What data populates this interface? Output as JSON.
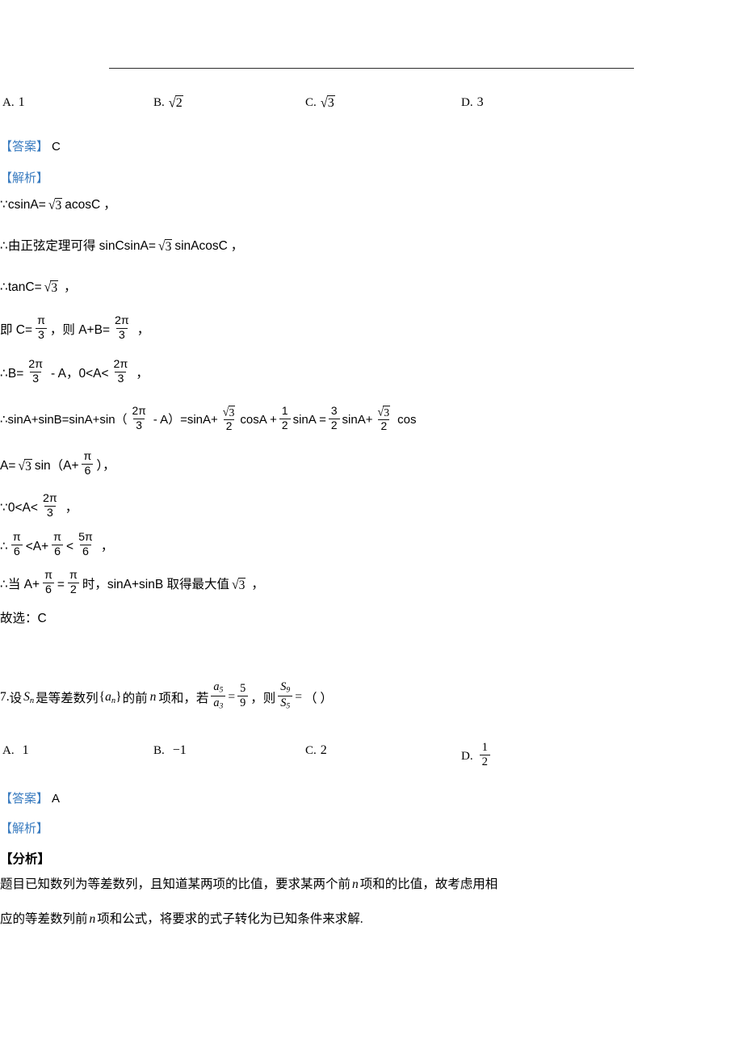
{
  "document": {
    "page_background": "#ffffff",
    "accent_blue": "#3a7cc0"
  },
  "question6": {
    "options": [
      {
        "label": "A.",
        "value": "1",
        "kind": "plain"
      },
      {
        "label": "B.",
        "value": "2",
        "kind": "sqrt"
      },
      {
        "label": "C.",
        "value": "3",
        "kind": "sqrt"
      },
      {
        "label": "D.",
        "value": "3",
        "kind": "plain"
      }
    ],
    "answer_tag": "【答案】",
    "answer_value": "C",
    "analysis_tag": "【解析】",
    "steps": {
      "s1_pre": "∵csinA=",
      "s1_rad": "3",
      "s1_post": "acosC",
      "s1_comma": "，",
      "s2_pre": "∴由正弦定理可得 sinCsinA=",
      "s2_rad": "3",
      "s2_post": "sinAcosC",
      "s2_comma": "，",
      "s3_pre": "∴tanC=",
      "s3_rad": "3",
      "s3_comma": "，",
      "s4_a": "即 C=",
      "s4_f1_num": "π",
      "s4_f1_den": "3",
      "s4_b": "，则 A+B=",
      "s4_f2_num": "2π",
      "s4_f2_den": "3",
      "s4_comma": "，",
      "s5_a": "∴B=",
      "s5_f1_num": "2π",
      "s5_f1_den": "3",
      "s5_b": "- A，0<A<",
      "s5_f2_num": "2π",
      "s5_f2_den": "3",
      "s5_comma": "，",
      "s6_a": "∴sinA+sinB=sinA+sin（",
      "s6_f1_num": "2π",
      "s6_f1_den": "3",
      "s6_b": "- A）=sinA+",
      "s6_f2_num_rad": "3",
      "s6_f2_den": "2",
      "s6_c": "cosA +",
      "s6_f3_num": "1",
      "s6_f3_den": "2",
      "s6_d": "sinA =",
      "s6_f4_num": "3",
      "s6_f4_den": "2",
      "s6_e": "sinA+",
      "s6_f5_num_rad": "3",
      "s6_f5_den": "2",
      "s6_f": "cos",
      "s7_a": "A=",
      "s7_rad": "3",
      "s7_b": "sin（A+",
      "s7_f_num": "π",
      "s7_f_den": "6",
      "s7_c": "），",
      "s8_a": "∵0<A<",
      "s8_f_num": "2π",
      "s8_f_den": "3",
      "s8_comma": "，",
      "s9_a": "∴",
      "s9_f1_num": "π",
      "s9_f1_den": "6",
      "s9_b": "<A+",
      "s9_f2_num": "π",
      "s9_f2_den": "6",
      "s9_c": "<",
      "s9_f3_num": "5π",
      "s9_f3_den": "6",
      "s9_comma": "，",
      "s10_a": "∴当 A+",
      "s10_f1_num": "π",
      "s10_f1_den": "6",
      "s10_b": "=",
      "s10_f2_num": "π",
      "s10_f2_den": "2",
      "s10_c": "时，sinA+sinB 取得最大值",
      "s10_rad": "3",
      "s10_comma": "，",
      "s11": "故选：C"
    }
  },
  "question7": {
    "number": "7.",
    "stem_a": "设",
    "stem_S": "S",
    "stem_S_sub": "n",
    "stem_b": "是等差数列",
    "stem_set_open": "{",
    "stem_a_var": "a",
    "stem_a_sub": "n",
    "stem_set_close": "}",
    "stem_c": "的前",
    "stem_n": "n",
    "stem_d": "项和，若",
    "frac1_num_var": "a",
    "frac1_num_sub": "5",
    "frac1_den_var": "a",
    "frac1_den_sub": "3",
    "eq1": "=",
    "frac2_num": "5",
    "frac2_den": "9",
    "stem_e": "，则",
    "frac3_num_var": "S",
    "frac3_num_sub": "9",
    "frac3_den_var": "S",
    "frac3_den_sub": "5",
    "eq2": "=",
    "stem_f": "（ ）",
    "options": [
      {
        "label": "A.",
        "value": "1",
        "kind": "plain"
      },
      {
        "label": "B.",
        "value": "−1",
        "kind": "plain"
      },
      {
        "label": "C.",
        "value": "2",
        "kind": "plain"
      },
      {
        "label": "D.",
        "num": "1",
        "den": "2",
        "kind": "frac"
      }
    ],
    "answer_tag": "【答案】",
    "answer_value": "A",
    "analysis_tag": "【解析】",
    "fenxi_tag": "【分析】",
    "para_line1_a": "题目已知数列为等差数列，且知道某两项的比值，要求某两个前",
    "para_line1_n": "n",
    "para_line1_b": "项和的比值，故考虑用相",
    "para_line2_a": "应的等差数列前",
    "para_line2_n": "n",
    "para_line2_b": "项和公式，将要求的式子转化为已知条件来求解."
  }
}
